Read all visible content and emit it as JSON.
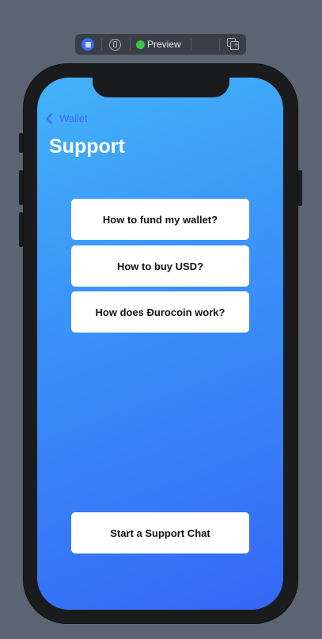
{
  "toolbar": {
    "live_icon": "live-preview-icon",
    "inspect_icon": "inspect-icon",
    "preview_label": "Preview",
    "preview_status_color": "#3ac54a",
    "device_icon": "device-settings-icon",
    "duplicate_icon": "duplicate-preview-icon"
  },
  "app": {
    "back_label": "Wallet",
    "title": "Support",
    "faq": [
      {
        "label": "How to fund my wallet?"
      },
      {
        "label": "How to buy USD?"
      },
      {
        "label": "How does Ðurocoin work?"
      }
    ],
    "chat_button": "Start a Support Chat",
    "accent_color": "#3a6ef2",
    "gradient_top": "#43b2f8",
    "gradient_bottom": "#3568f5"
  }
}
